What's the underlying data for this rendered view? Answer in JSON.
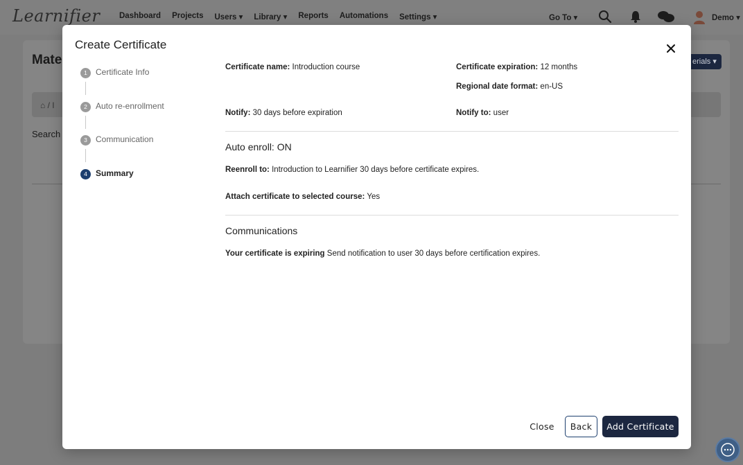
{
  "app": {
    "logo": "Learnifier",
    "nav": [
      "Dashboard",
      "Projects",
      "Users ▾",
      "Library ▾",
      "Reports",
      "Automations",
      "Settings ▾"
    ],
    "goto_label": "Go To ▾",
    "user_label": "Demo ▾",
    "page_title": "Mate",
    "breadcrumb_text": "⌂ / I",
    "search_label": "Search",
    "materials_button": "erials ▾"
  },
  "modal": {
    "title": "Create Certificate",
    "steps": [
      {
        "num": "1",
        "label": "Certificate Info"
      },
      {
        "num": "2",
        "label": "Auto re-enrollment"
      },
      {
        "num": "3",
        "label": "Communication"
      },
      {
        "num": "4",
        "label": "Summary"
      }
    ],
    "summary": {
      "certificate_name_label": "Certificate name:",
      "certificate_name_value": "Introduction course",
      "expiration_label": "Certificate expiration:",
      "expiration_value": "12 months",
      "date_format_label": "Regional date format:",
      "date_format_value": "en-US",
      "notify_label": "Notify:",
      "notify_value": "30 days before expiration",
      "notify_to_label": "Notify to:",
      "notify_to_value": "user",
      "auto_enroll_heading": "Auto enroll: ON",
      "reenroll_label": "Reenroll to:",
      "reenroll_value": "Introduction to Learnifier 30 days before certificate expires.",
      "attach_label": "Attach certificate to selected course:",
      "attach_value": "Yes",
      "communications_heading": "Communications",
      "comm_label": "Your certificate is expiring",
      "comm_value": "Send notification to user 30 days before certification expires."
    },
    "buttons": {
      "close": "Close",
      "back": "Back",
      "add": "Add Certificate"
    }
  },
  "colors": {
    "primary": "#1c2740",
    "active_step": "#1d3f6e"
  }
}
